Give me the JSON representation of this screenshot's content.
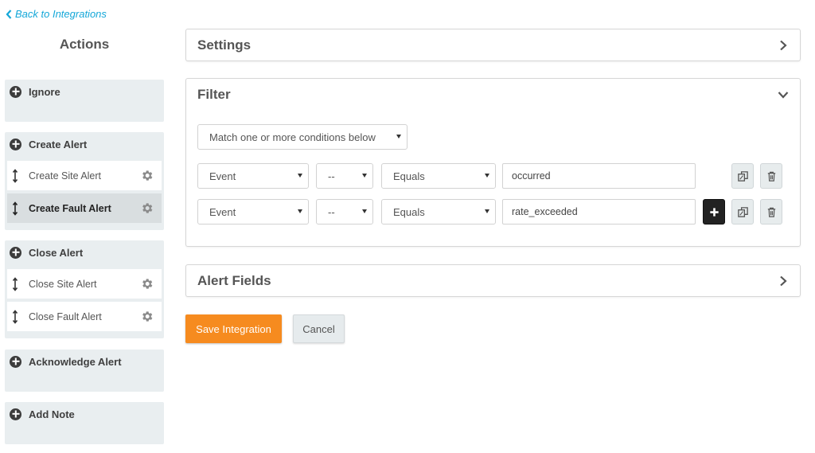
{
  "back_link": {
    "label": "Back to Integrations"
  },
  "sidebar": {
    "title": "Actions",
    "groups": [
      {
        "label": "Ignore",
        "items": []
      },
      {
        "label": "Create Alert",
        "items": [
          {
            "label": "Create Site Alert",
            "active": false
          },
          {
            "label": "Create Fault Alert",
            "active": true
          }
        ]
      },
      {
        "label": "Close Alert",
        "items": [
          {
            "label": "Close Site Alert",
            "active": false
          },
          {
            "label": "Close Fault Alert",
            "active": false
          }
        ]
      },
      {
        "label": "Acknowledge Alert",
        "items": []
      },
      {
        "label": "Add Note",
        "items": []
      }
    ]
  },
  "settings_panel": {
    "title": "Settings"
  },
  "filter_panel": {
    "title": "Filter",
    "match_mode": "Match one or more conditions below",
    "conditions": [
      {
        "field": "Event",
        "modifier": "--",
        "operator": "Equals",
        "value": "occurred"
      },
      {
        "field": "Event",
        "modifier": "--",
        "operator": "Equals",
        "value": "rate_exceeded"
      }
    ]
  },
  "alert_fields_panel": {
    "title": "Alert Fields"
  },
  "buttons": {
    "save": "Save Integration",
    "cancel": "Cancel"
  },
  "colors": {
    "link": "#14a7d8",
    "primary": "#f68b1f",
    "sidebar_bg": "#e9eef0",
    "active_item": "#d9dee0"
  }
}
